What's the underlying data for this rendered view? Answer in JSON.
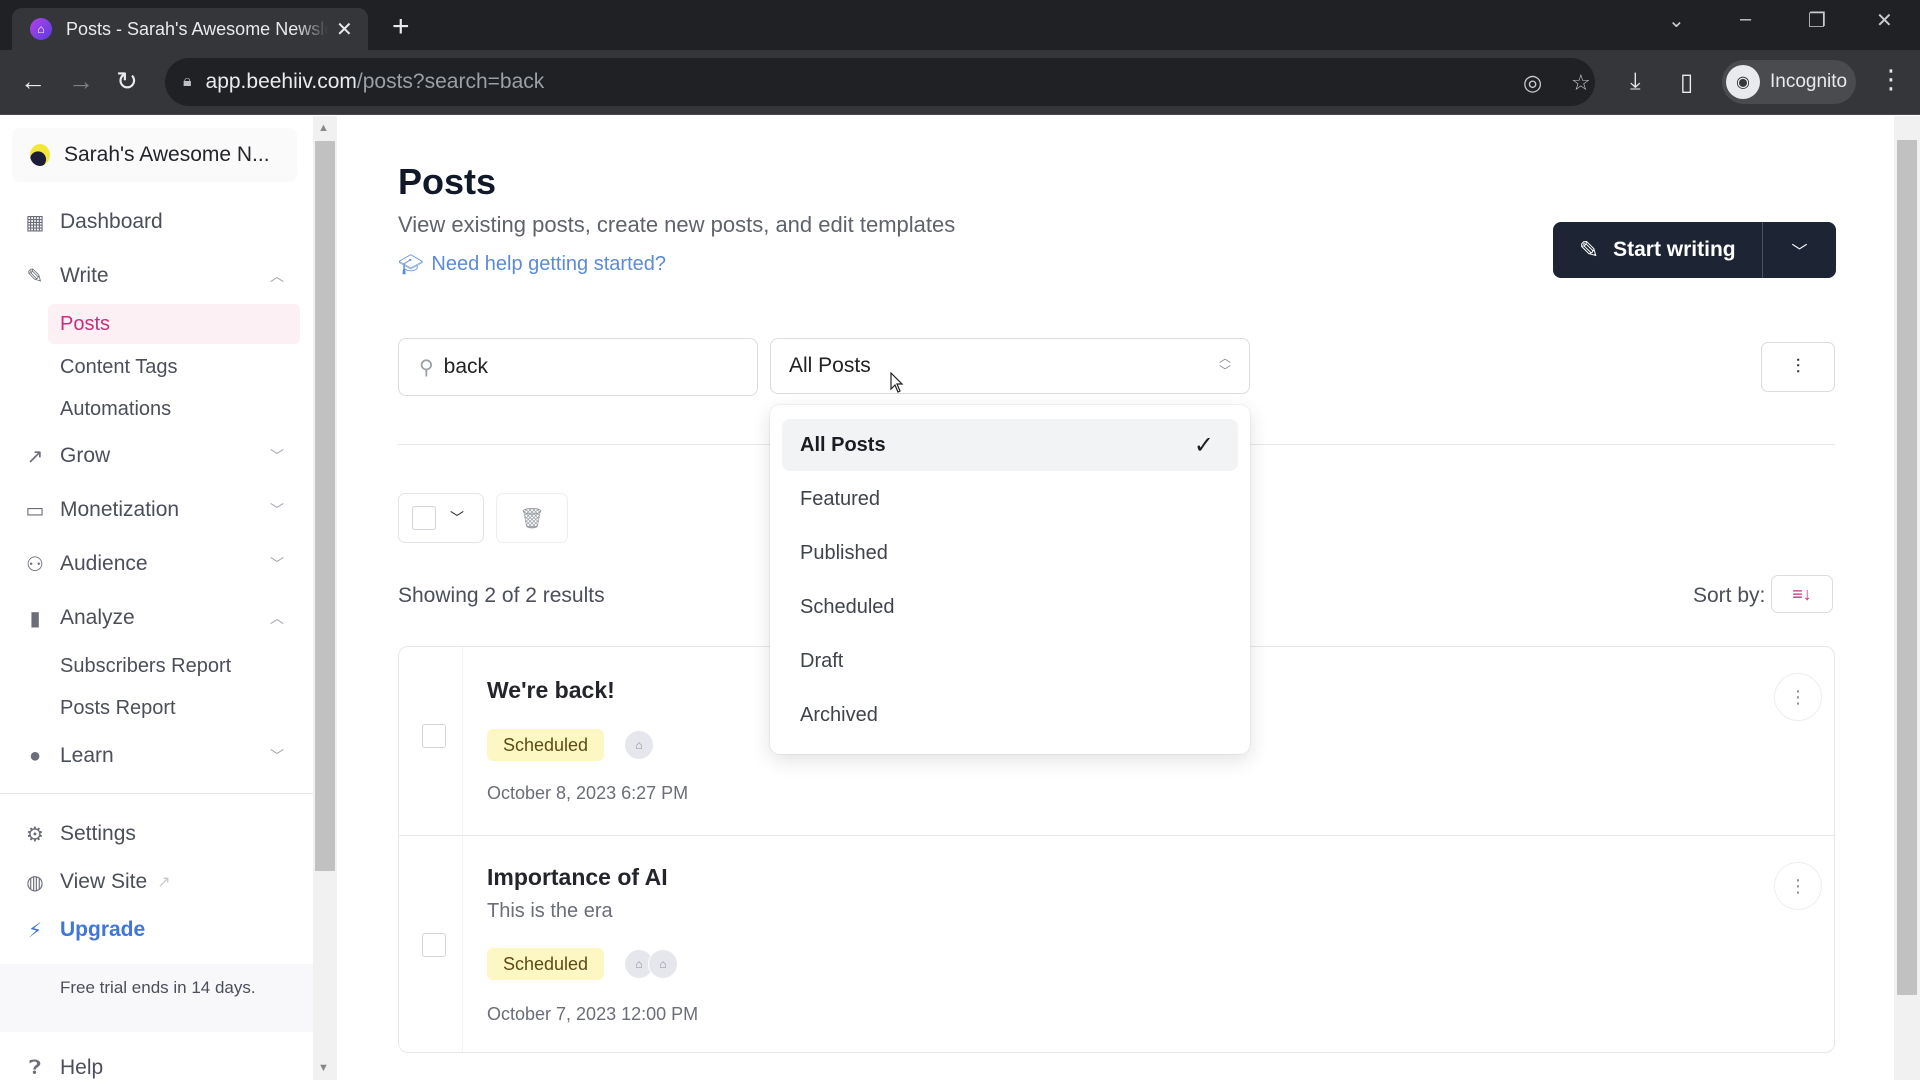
{
  "browser": {
    "tab_title": "Posts - Sarah's Awesome Newsletter",
    "tab_close": "✕",
    "new_tab": "+",
    "url_host": "app.beehiiv.com",
    "url_path": "/posts?search=back",
    "profile_label": "Incognito",
    "window_controls": {
      "tabsearch": "⌄",
      "minimize": "–",
      "restore": "❐",
      "close": "✕"
    }
  },
  "sidebar": {
    "brand_name": "Sarah's Awesome N...",
    "items": [
      {
        "label": "Dashboard",
        "icon": "dashboard-icon"
      },
      {
        "label": "Write",
        "icon": "pencil-icon",
        "expanded": true
      },
      {
        "label": "Grow",
        "icon": "trend-icon",
        "expanded": false
      },
      {
        "label": "Monetization",
        "icon": "money-icon",
        "expanded": false
      },
      {
        "label": "Audience",
        "icon": "users-icon",
        "expanded": false
      },
      {
        "label": "Analyze",
        "icon": "bar-chart-icon",
        "expanded": true
      },
      {
        "label": "Learn",
        "icon": "bulb-icon",
        "expanded": false
      }
    ],
    "write_subitems": [
      "Posts",
      "Content Tags",
      "Automations"
    ],
    "analyze_subitems": [
      "Subscribers Report",
      "Posts Report"
    ],
    "settings": "Settings",
    "view_site": "View Site",
    "upgrade": "Upgrade",
    "trial_text": "Free trial ends in 14 days.",
    "help": "Help",
    "active_item": "Posts"
  },
  "main": {
    "title": "Posts",
    "subtitle": "View existing posts, create new posts, and edit templates",
    "help_link": "Need help getting started?",
    "start_writing": "Start writing",
    "search": {
      "value": "back",
      "placeholder": "Search"
    },
    "filter_select": {
      "value": "All Posts"
    },
    "showing": "Showing 2 of 2 results",
    "sort_label": "Sort by:"
  },
  "dropdown": {
    "options": [
      "All Posts",
      "Featured",
      "Published",
      "Scheduled",
      "Draft",
      "Archived"
    ],
    "selected": "All Posts"
  },
  "posts": [
    {
      "title": "We're back!",
      "subtitle": "",
      "status": "Scheduled",
      "date": "October 8, 2023 6:27 PM",
      "avatars": 1
    },
    {
      "title": "Importance of AI",
      "subtitle": "This is the era",
      "status": "Scheduled",
      "date": "October 7, 2023 12:00 PM",
      "avatars": 2
    }
  ],
  "colors": {
    "accent": "#c3317a",
    "button_dark": "#1d2433",
    "badge_scheduled": "#fdf7c3",
    "link": "#5b8bd6"
  }
}
